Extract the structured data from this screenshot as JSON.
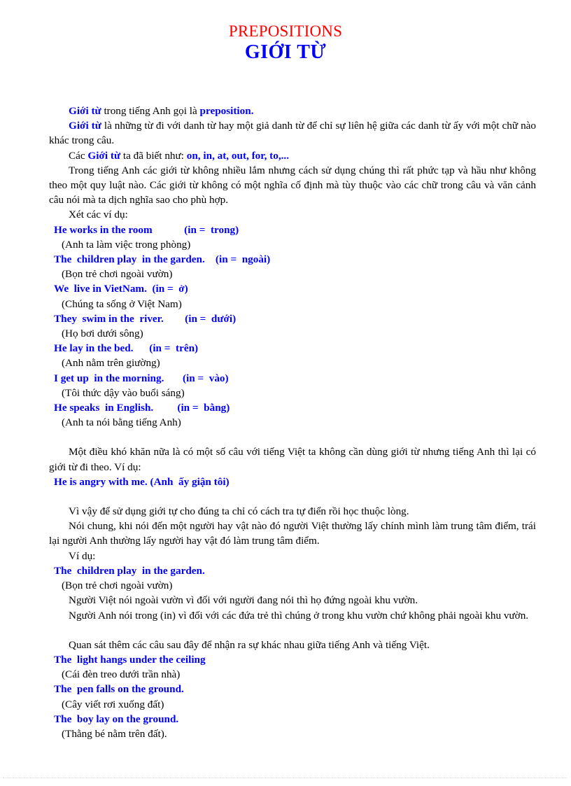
{
  "document": {
    "title_en": "PREPOSITIONS",
    "title_vi": "GIỚI TỪ",
    "colors": {
      "title_en": "#ff0000",
      "title_vi": "#0000ff",
      "highlight": "#0000ff",
      "body": "#000000",
      "footer_rule": "#d8d8e4"
    }
  },
  "intro": {
    "line1_a": "Giới từ",
    "line1_b": " trong tiếng Anh  gọi là ",
    "line1_c": "preposition.",
    "line2_a": "Giới từ",
    "line2_b": " là những từ đi với  danh từ hay một giả danh từ để chỉ sự liên hệ giữa các danh từ ấy với một chữ nào khác trong câu.",
    "line3_a": "Các ",
    "line3_b": "Giới từ",
    "line3_c": " ta đã biết như: ",
    "line3_d": "on, in, at, out, for, to,...",
    "para4": "Trong tiếng Anh  các giới từ không nhiều lắm nhưng  cách sử dụng chúng thì rất phức tạp và  hầu như không theo một quy luật nào. Các giới từ không  có một nghĩa cố định mà tùy thuộc vào  các chữ trong câu và văn  cảnh câu nói mà ta dịch nghĩa sao cho phù hợp.",
    "examples_label": "Xét các ví dụ:"
  },
  "examples_in": [
    {
      "english": "He works in the room            (in =  trong)",
      "translation": "(Anh  ta làm việc trong phòng)"
    },
    {
      "english": "The  children play  in the garden.    (in =  ngoài)",
      "translation": "(Bọn trẻ chơi ngoài  vườn)"
    },
    {
      "english": "We  live in VietNam.  (in =  ở)",
      "translation": "(Chúng  ta sống ở Việt Nam)"
    },
    {
      "english": "They  swim in the  river.        (in =  dưới)",
      "translation": "(Họ bơi dưới sông)"
    },
    {
      "english": "He lay in the bed.      (in =  trên)",
      "translation": "(Anh  nằm trên giường)"
    },
    {
      "english": "I get up  in the morning.       (in =  vào)",
      "translation": "(Tôi thức dậy vào  buổi sáng)"
    },
    {
      "english": "He speaks  in English.         (in =  bằng)",
      "translation": "(Anh  ta nói bằng tiếng Anh)"
    }
  ],
  "section_angry": {
    "para": "Một điều khó khăn nữa là có một số câu với tiếng Việt ta không  cần dùng  giới từ nhưng  tiếng Anh thì lại có giới từ đi theo. Ví dụ:",
    "example": "He is angry with me. (Anh  ấy giận tôi)"
  },
  "section_advice": {
    "para1": "Vì vậy  để sử dụng  giới tự cho đúng ta chỉ có cách tra tự điển rồi học thuộc lòng.",
    "para2": "Nói chung,  khi nói đến một người  hay vật nào đó người  Việt thường lấy  chính mình  làm trung tâm điểm, trái lại người  Anh  thường lấy người  hay vật  đó làm trung tâm điểm.",
    "example_label": "Ví dụ:",
    "example_en": "The  children play  in the garden.",
    "example_vi": "(Bọn trẻ chơi ngoài  vườn)",
    "note1": "Người Việt nói ngoài vườn vì đối với người đang nói thì họ đứng ngoài  khu vườn.",
    "note2": "Người Anh  nói trong (in) vì đối với  các đứa trẻ thì chúng  ở trong khu vườn  chứ không  phải ngoài khu vườn."
  },
  "section_observe": {
    "para": "Quan sát thêm các câu sau đây để nhận ra sự khác nhau  giữa tiếng Anh  và tiếng Việt.",
    "examples": [
      {
        "english": "The  light hangs under the ceiling",
        "translation": "(Cái đèn treo dưới trần nhà)"
      },
      {
        "english": "The  pen falls on the ground.",
        "translation": "(Cây viết rơi xuống đất)"
      },
      {
        "english": "The  boy lay on the ground.",
        "translation": "(Thằng  bé nằm trên đất)."
      }
    ]
  }
}
